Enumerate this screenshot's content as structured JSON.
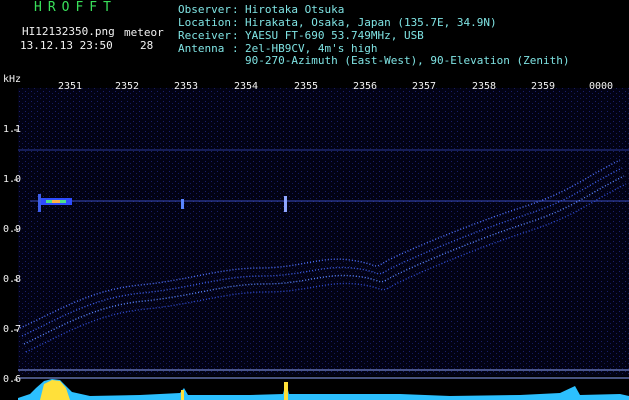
{
  "header": {
    "title": "HROFFT",
    "filename": "HI12132350.png",
    "datetime": "13.12.13 23:50",
    "meteor_label": "meteor",
    "meteor_count": "28"
  },
  "info": [
    {
      "key": "Observer",
      "value": "Hirotaka Otsuka"
    },
    {
      "key": "Location",
      "value": "Hirakata, Osaka, Japan (135.7E, 34.9N)"
    },
    {
      "key": "Receiver",
      "value": "YAESU FT-690 53.749MHz, USB"
    },
    {
      "key": "Antenna",
      "value": "2el-HB9CV, 4m's high"
    },
    {
      "key": "",
      "value": "90-270-Azimuth (East-West), 90-Elevation (Zenith)"
    }
  ],
  "y_unit": "kHz",
  "y_ticks": [
    "1.1",
    "1.0",
    "0.9",
    "0.8",
    "0.7",
    "0.6"
  ],
  "x_ticks": [
    "2351",
    "2352",
    "2353",
    "2354",
    "2355",
    "2356",
    "2357",
    "2358",
    "2359",
    "0000"
  ],
  "colors": {
    "background": "#000000",
    "header_cyan": "#7fe3e3",
    "title_green": "#39e05a",
    "trace": "#4a6bff"
  }
}
